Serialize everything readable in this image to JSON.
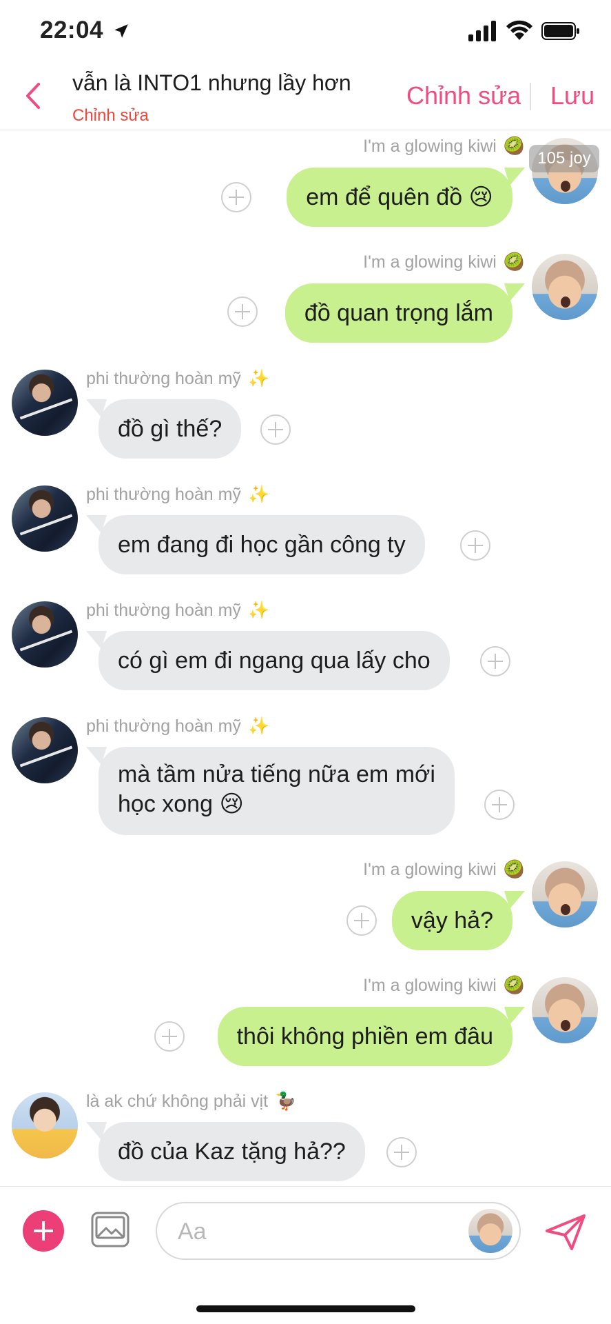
{
  "status_bar": {
    "time": "22:04"
  },
  "header": {
    "title": "vẫn là INTO1 nhưng lầy hơn",
    "subtitle": "Chỉnh sửa",
    "edit_label": "Chỉnh sửa",
    "save_label": "Lưu"
  },
  "overlay_badge": "105 joy",
  "messages": [
    {
      "side": "right",
      "sender": "I'm a glowing kiwi",
      "sender_emoji": "🥝",
      "text": "em để quên đồ 😢",
      "avatar": "avatar-shaved-head"
    },
    {
      "side": "right",
      "sender": "I'm a glowing kiwi",
      "sender_emoji": "🥝",
      "text": "đồ quan trọng lắm",
      "avatar": "avatar-shaved-head"
    },
    {
      "side": "left",
      "sender": "phi thường hoàn mỹ",
      "sender_emoji": "✨",
      "text": "đồ gì thế?",
      "avatar": "avatar-dark-jacket"
    },
    {
      "side": "left",
      "sender": "phi thường hoàn mỹ",
      "sender_emoji": "✨",
      "text": "em đang đi học gần công ty",
      "avatar": "avatar-dark-jacket"
    },
    {
      "side": "left",
      "sender": "phi thường hoàn mỹ",
      "sender_emoji": "✨",
      "text": "có gì em đi ngang qua lấy cho",
      "avatar": "avatar-dark-jacket"
    },
    {
      "side": "left",
      "sender": "phi thường hoàn mỹ",
      "sender_emoji": "✨",
      "text_line1": "mà tầm nửa tiếng nữa em mới",
      "text_line2": "học xong 😢",
      "avatar": "avatar-dark-jacket"
    },
    {
      "side": "right",
      "sender": "I'm a glowing kiwi",
      "sender_emoji": "🥝",
      "text": "vậy hả?",
      "avatar": "avatar-shaved-head"
    },
    {
      "side": "right",
      "sender": "I'm a glowing kiwi",
      "sender_emoji": "🥝",
      "text": "thôi không phiền em đâu",
      "avatar": "avatar-shaved-head"
    },
    {
      "side": "left",
      "sender": "là ak chứ không phải vịt",
      "sender_emoji": "🦆",
      "text": "đồ của Kaz tặng hả??",
      "avatar": "avatar-boy-yellow"
    }
  ],
  "composer": {
    "placeholder": "Aa"
  },
  "colors": {
    "accent": "#ef4c7f",
    "right_bubble": "#c8f08f",
    "left_bubble": "#e8e9eb",
    "subtitle": "#f0463c"
  }
}
